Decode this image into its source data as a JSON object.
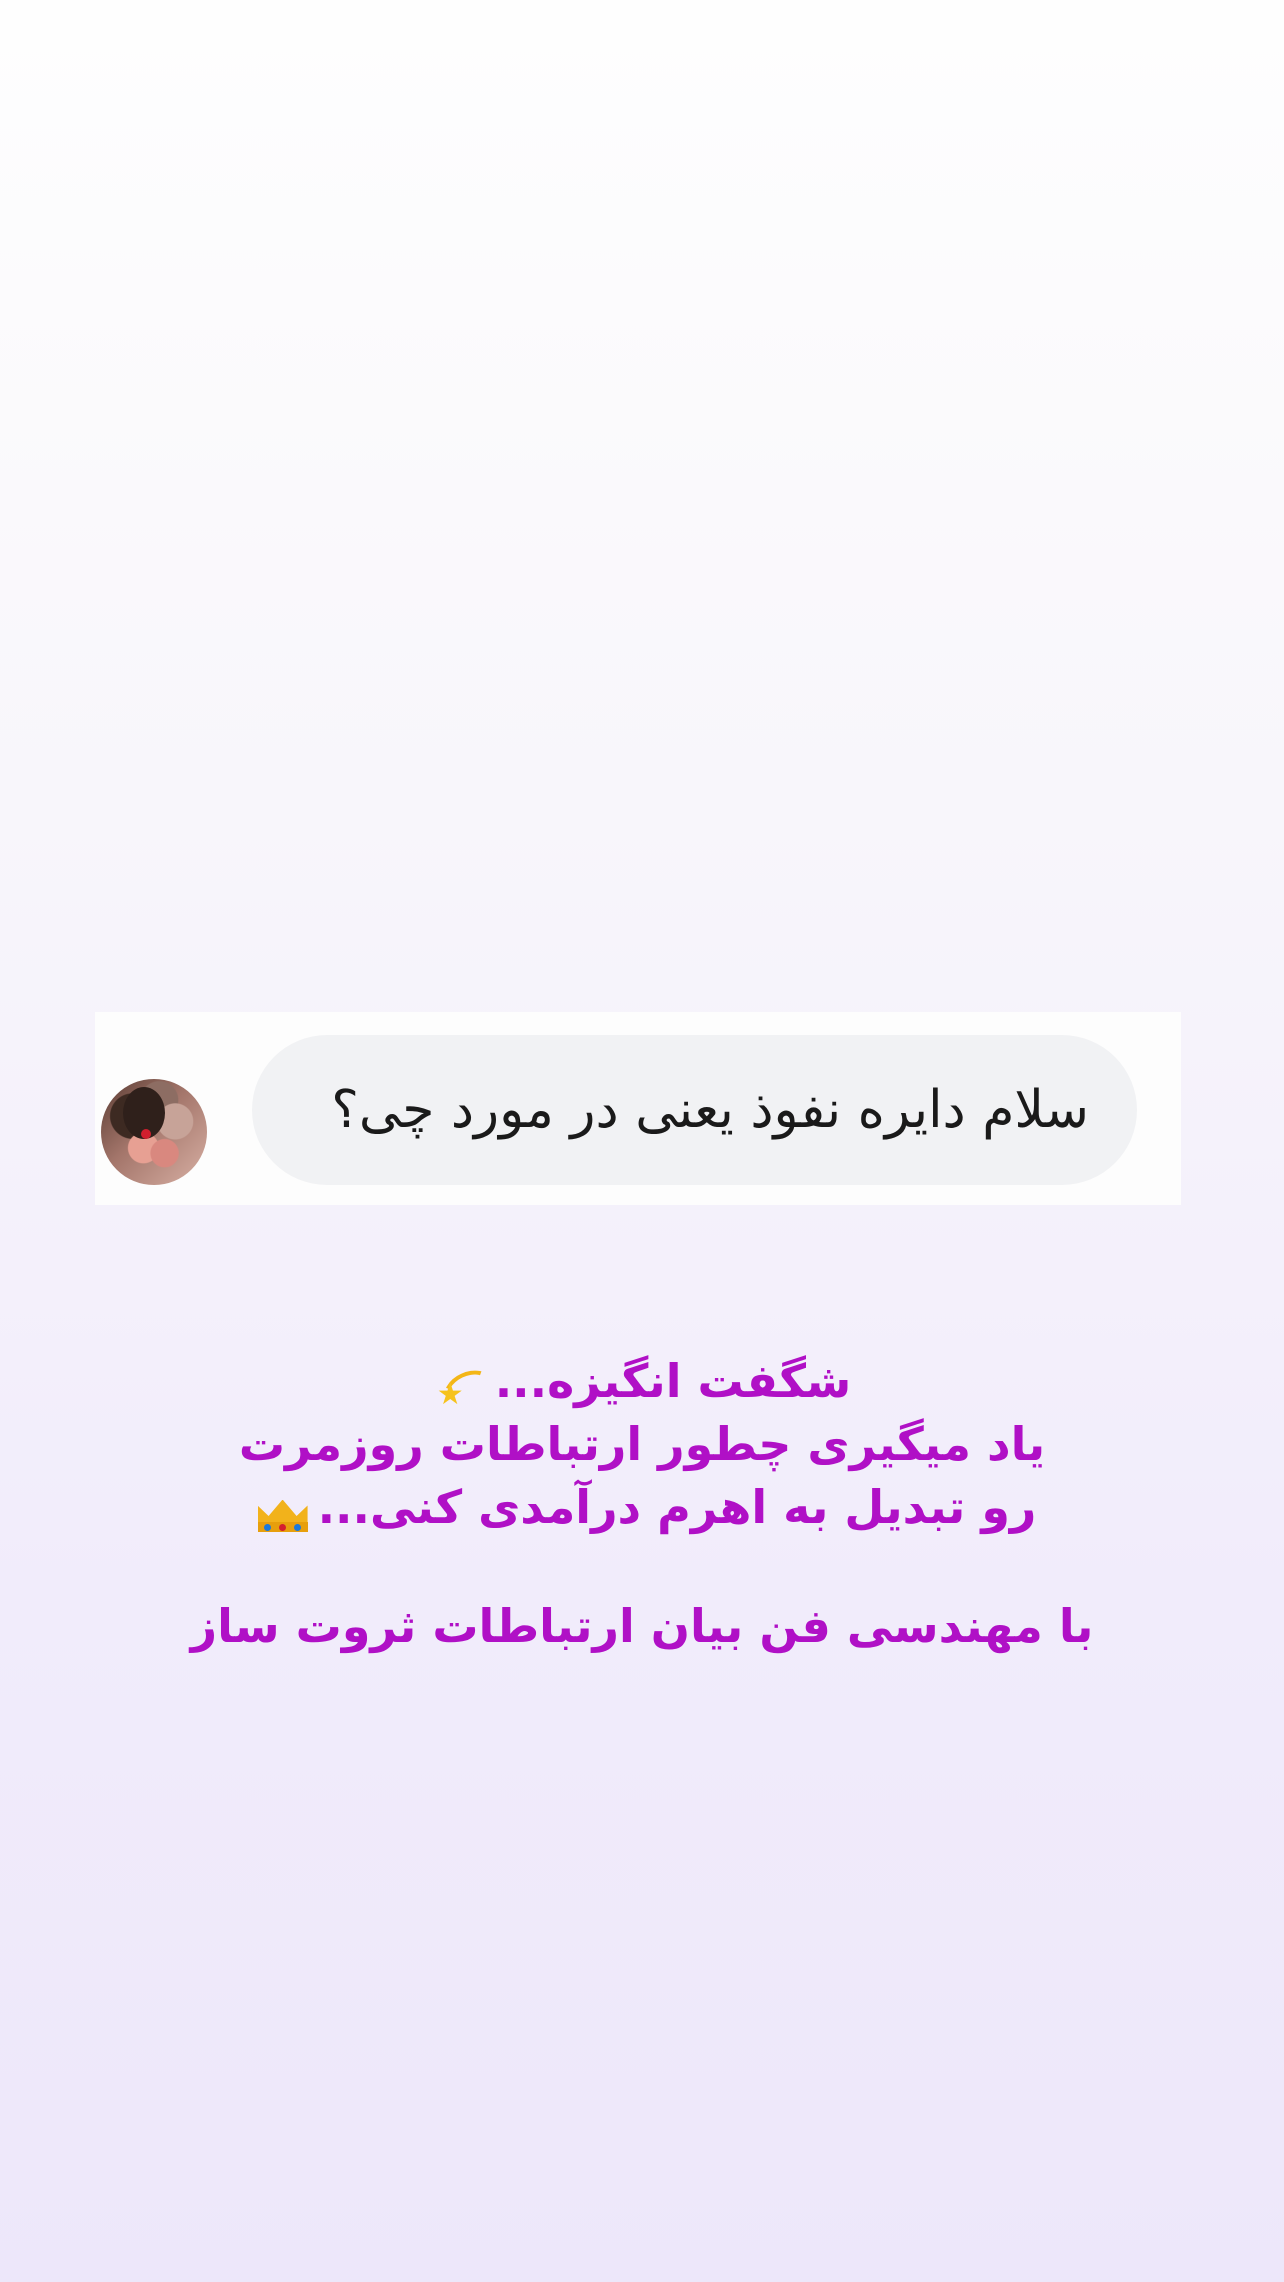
{
  "message": {
    "text": "سلام دایره نفوذ یعنی در مورد چی؟"
  },
  "caption": {
    "line1": "شگفت انگیزه...",
    "line2": "یاد میگیری چطور ارتباطات روزمرت",
    "line3": "رو تبدیل به اهرم درآمدی کنی...",
    "line4": "با مهندسی فن بیان ارتباطات ثروت ساز",
    "text_color": "#b010c6"
  },
  "icons": {
    "emoji1": "dizzy-star-icon",
    "emoji2": "crown-icon"
  }
}
